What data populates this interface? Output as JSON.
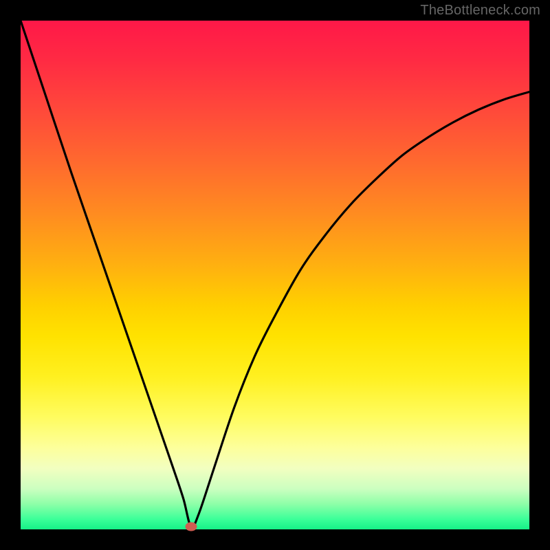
{
  "watermark": "TheBottleneck.com",
  "chart_data": {
    "type": "line",
    "title": "",
    "xlabel": "",
    "ylabel": "",
    "xlim": [
      0,
      100
    ],
    "ylim": [
      0,
      100
    ],
    "grid": false,
    "legend": false,
    "series": [
      {
        "name": "bottleneck-curve",
        "x": [
          0,
          5,
          10,
          15,
          20,
          25,
          30,
          32,
          33.5,
          35,
          38,
          42,
          46,
          50,
          55,
          60,
          65,
          70,
          75,
          80,
          85,
          90,
          95,
          100
        ],
        "y": [
          100,
          85,
          70,
          55.5,
          41,
          26.5,
          12,
          6,
          0.5,
          3,
          12,
          24,
          34,
          42,
          51,
          58,
          64,
          69,
          73.5,
          77,
          80,
          82.5,
          84.5,
          86
        ]
      }
    ],
    "marker": {
      "x": 33.5,
      "y": 0.5
    },
    "gradient_stops": [
      {
        "pct": 0,
        "color": "#ff1848"
      },
      {
        "pct": 8,
        "color": "#ff2b43"
      },
      {
        "pct": 18,
        "color": "#ff4a3a"
      },
      {
        "pct": 28,
        "color": "#ff6a2e"
      },
      {
        "pct": 38,
        "color": "#ff8c20"
      },
      {
        "pct": 48,
        "color": "#ffb010"
      },
      {
        "pct": 56,
        "color": "#ffd000"
      },
      {
        "pct": 62,
        "color": "#ffe200"
      },
      {
        "pct": 70,
        "color": "#fff020"
      },
      {
        "pct": 78,
        "color": "#fffc60"
      },
      {
        "pct": 84,
        "color": "#fdff9c"
      },
      {
        "pct": 88,
        "color": "#f2ffc0"
      },
      {
        "pct": 92,
        "color": "#ccffc0"
      },
      {
        "pct": 95,
        "color": "#8effa8"
      },
      {
        "pct": 98,
        "color": "#3bff99"
      },
      {
        "pct": 100,
        "color": "#16f187"
      }
    ],
    "colors": {
      "curve": "#000000",
      "marker": "#cf5c51",
      "frame": "#000000"
    }
  }
}
